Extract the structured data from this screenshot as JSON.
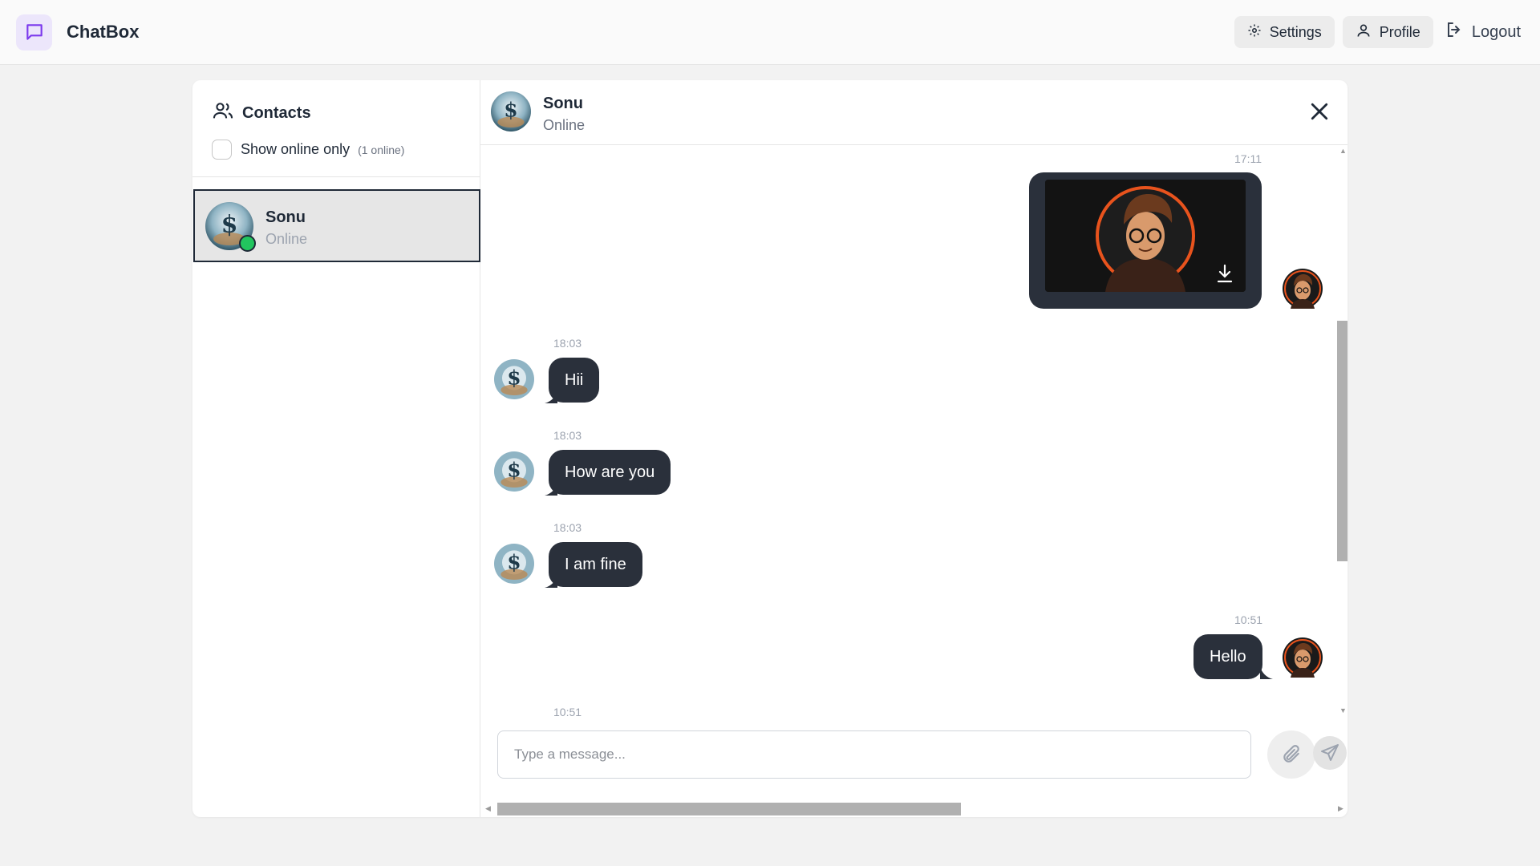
{
  "app": {
    "name": "ChatBox",
    "accent": "#7c3aed",
    "logo_bg": "#ece6fb"
  },
  "nav": {
    "settings_label": "Settings",
    "profile_label": "Profile",
    "logout_label": "Logout"
  },
  "sidebar": {
    "title": "Contacts",
    "filter_label": "Show online only",
    "filter_count": "(1 online)",
    "filter_checked": false,
    "contacts": [
      {
        "name": "Sonu",
        "status": "Online",
        "selected": true,
        "online_color": "#22c55e"
      }
    ]
  },
  "chat": {
    "contact_name": "Sonu",
    "contact_status": "Online",
    "bubble_color": "#2a303b",
    "messages": [
      {
        "direction": "out",
        "type": "image",
        "time": "17:11"
      },
      {
        "direction": "in",
        "type": "text",
        "time": "18:03",
        "text": "Hii"
      },
      {
        "direction": "in",
        "type": "text",
        "time": "18:03",
        "text": "How are you"
      },
      {
        "direction": "in",
        "type": "text",
        "time": "18:03",
        "text": "I am fine"
      },
      {
        "direction": "out",
        "type": "text",
        "time": "10:51",
        "text": "Hello"
      },
      {
        "direction": "in",
        "type": "text",
        "time": "10:51"
      }
    ]
  },
  "composer": {
    "placeholder": "Type a message...",
    "value": ""
  }
}
